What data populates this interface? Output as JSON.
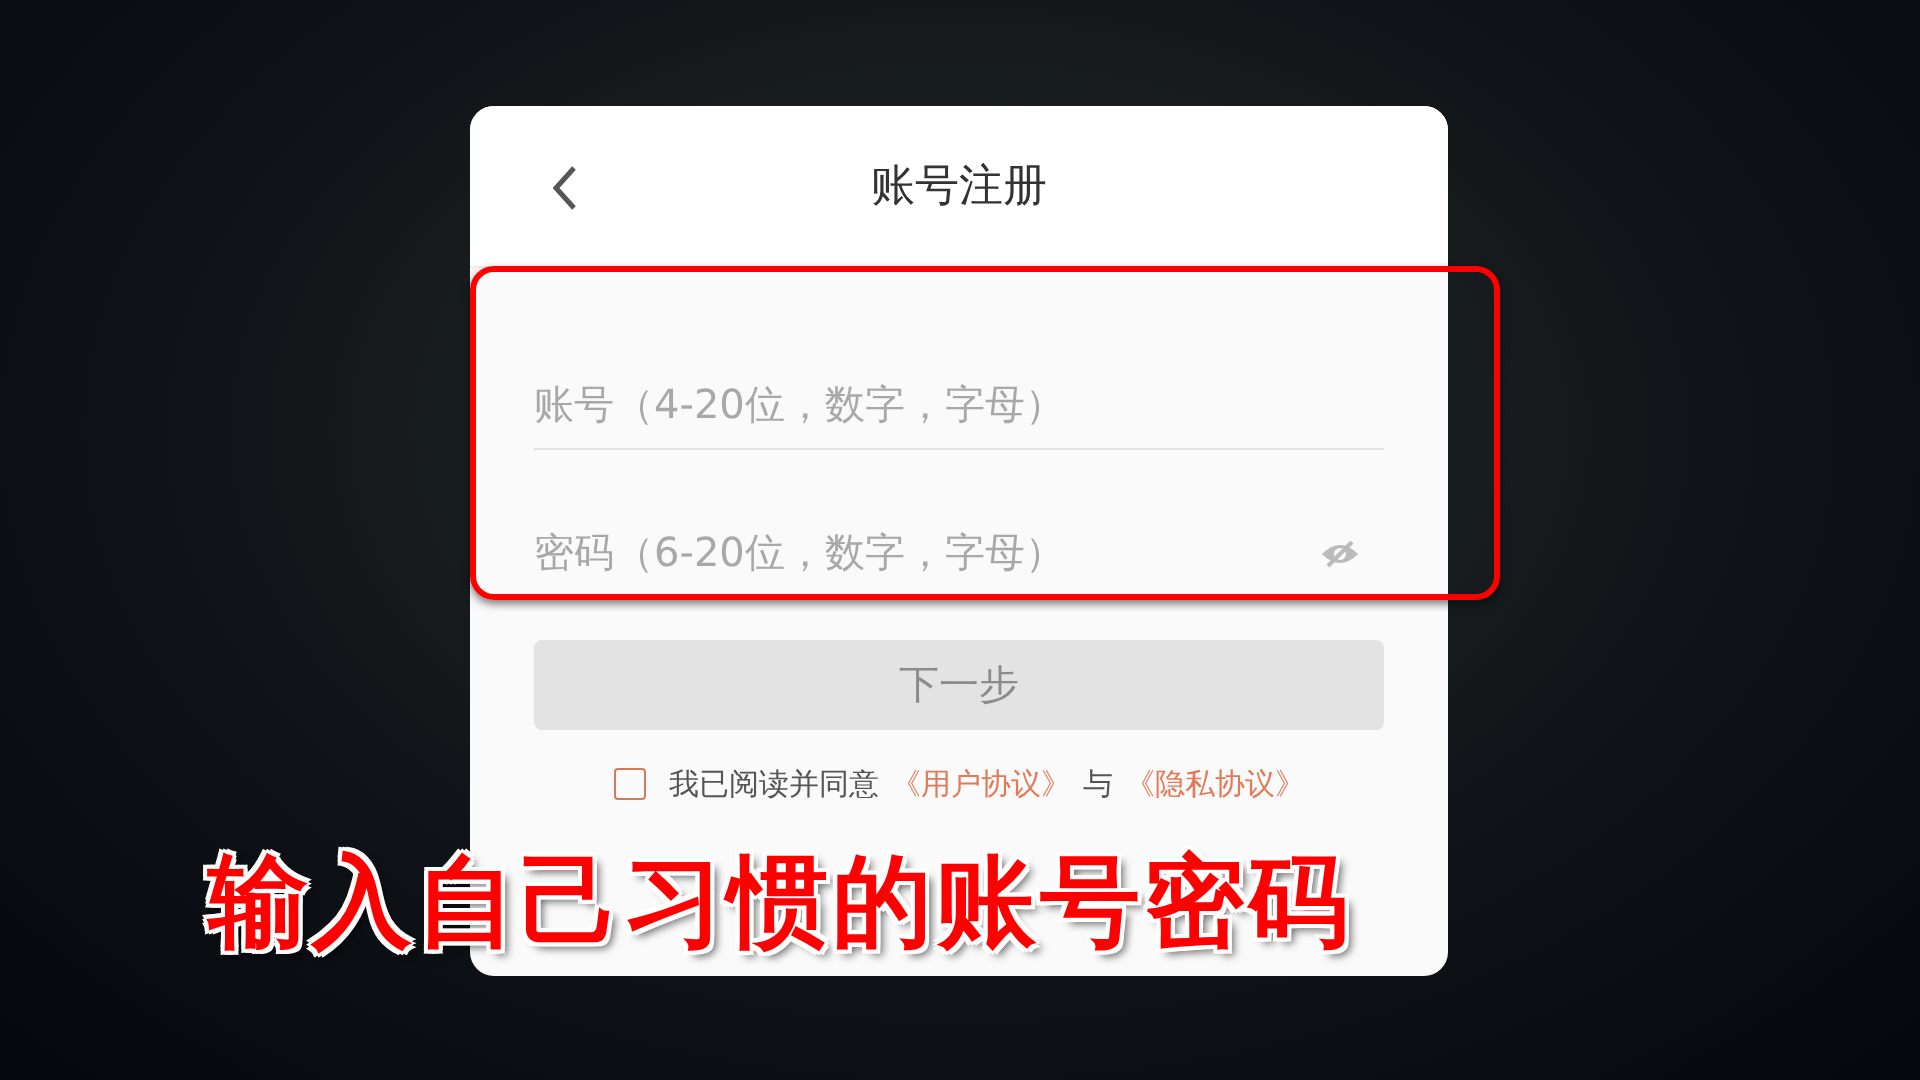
{
  "header": {
    "title": "账号注册"
  },
  "fields": [
    {
      "kind": "text",
      "placeholder": "账号（4-20位，数字，字母）"
    },
    {
      "kind": "password",
      "placeholder": "密码（6-20位，数字，字母）"
    }
  ],
  "next_button": {
    "label": "下一步",
    "disabled": true
  },
  "agreement": {
    "checked": false,
    "text": "我已阅读并同意",
    "links": [
      "《用户协议》",
      "《隐私协议》"
    ],
    "joiner": "与"
  },
  "caption": "输入自己习惯的账号密码"
}
